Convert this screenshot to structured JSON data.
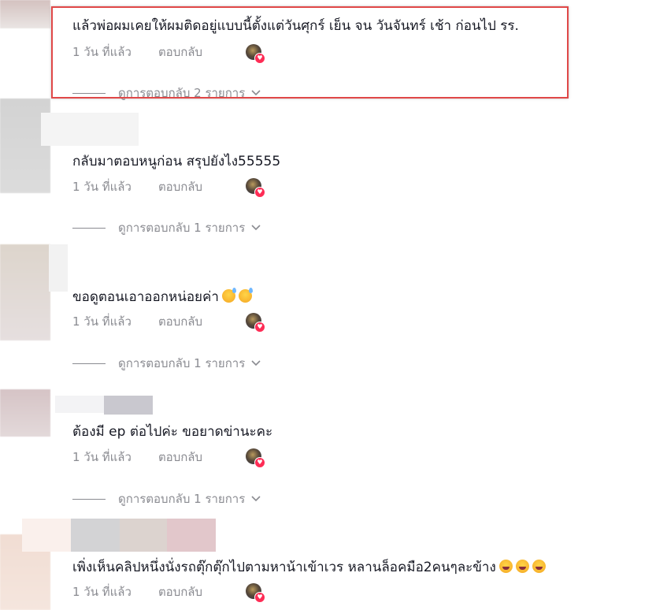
{
  "comments": [
    {
      "text": "แล้วพ่อผมเคยให้ผมติดอยู่แบบนี้ตั้งแต่วันศุกร์ เย็น จน วันจันทร์ เช้า ก่อนไป รร.",
      "time": "1 วัน ที่แล้ว",
      "reply": "ตอบกลับ",
      "view_replies": "ดูการตอบกลับ 2 รายการ"
    },
    {
      "text": "กลับมาตอบหนูก่อน สรุปยังไง55555",
      "time": "1 วัน ที่แล้ว",
      "reply": "ตอบกลับ",
      "view_replies": "ดูการตอบกลับ 1 รายการ"
    },
    {
      "text": "ขอดูตอนเอาออกหน่อยค่า",
      "time": "1 วัน ที่แล้ว",
      "reply": "ตอบกลับ",
      "view_replies": "ดูการตอบกลับ 1 รายการ"
    },
    {
      "text": "ต้องมี ep ต่อไปค่ะ ขอยาดข่านะคะ",
      "time": "1 วัน ที่แล้ว",
      "reply": "ตอบกลับ",
      "view_replies": "ดูการตอบกลับ 1 รายการ"
    },
    {
      "text": "เพิ่งเห็นคลิปหนึ่งนั่งรถตุ๊กตุ๊กไปตามหาน้าเข้าเวร หลานล็อคมือ2คนๆละข้าง",
      "time": "1 วัน ที่แล้ว",
      "reply": "ตอบกลับ"
    }
  ],
  "colors": {
    "highlight_border": "#e04848",
    "muted_text": "#8a8b91",
    "like_heart": "#fe2c55"
  },
  "icons": [
    "creator-liked-avatar-icon",
    "heart-icon",
    "chevron-down-icon",
    "sweat-smile-emoji",
    "rofl-emoji"
  ]
}
